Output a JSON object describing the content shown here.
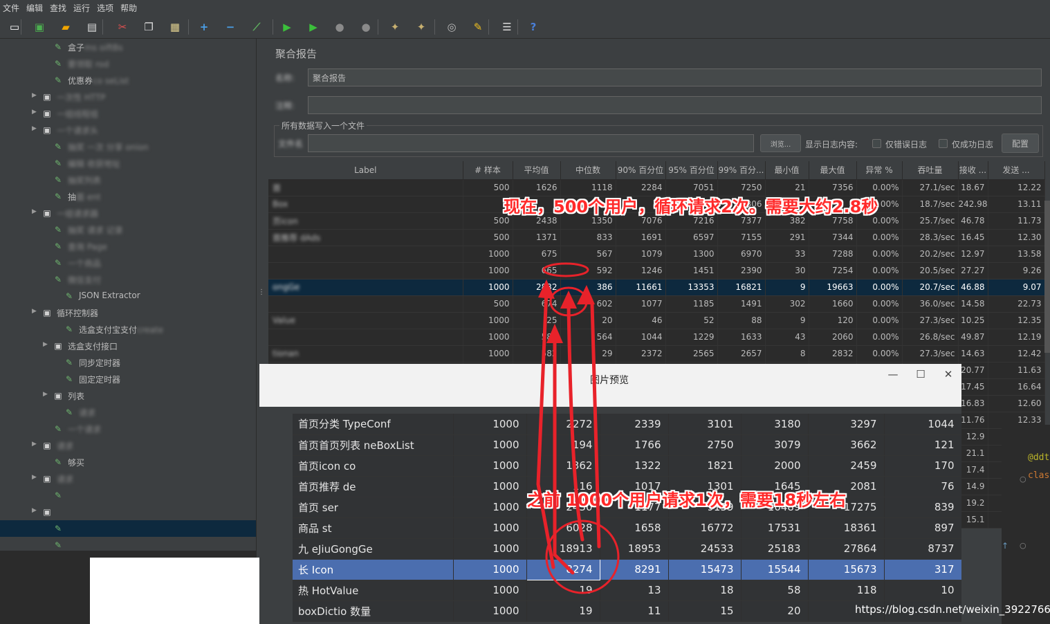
{
  "menu": {
    "items": [
      "文件",
      "编辑",
      "查找",
      "运行",
      "选项",
      "帮助"
    ]
  },
  "toolbar": {
    "icons": [
      "new-icon",
      "templates-icon",
      "open-icon",
      "save-icon",
      "cut-icon",
      "copy-icon",
      "paste-icon",
      "expand-icon",
      "collapse-icon",
      "toggle-icon",
      "start-icon",
      "start-no-pause-icon",
      "stop-icon",
      "shutdown-icon",
      "clear-icon",
      "clear-all-icon",
      "search-icon",
      "reset-search-icon",
      "function-helper-icon",
      "help-icon"
    ]
  },
  "tree": {
    "items": [
      {
        "label": "盒子",
        "blur": "ms oiftBs",
        "indent": 1
      },
      {
        "label": "",
        "blur": "要领取 rod",
        "indent": 1
      },
      {
        "label": "优惠券",
        "blur": "co seList",
        "indent": 1
      },
      {
        "label": "",
        "blur": "一次性 HTTP",
        "indent": 0,
        "expand": true
      },
      {
        "label": "",
        "blur": "一组线程组",
        "indent": 0,
        "expand": true
      },
      {
        "label": "",
        "blur": "一个请求头",
        "indent": 0,
        "expand": true
      },
      {
        "label": "",
        "blur": "抽奖 一次 分享 onion",
        "indent": 1
      },
      {
        "label": "",
        "blur": "编辑 收获地址",
        "indent": 1
      },
      {
        "label": "",
        "blur": "抽奖列表",
        "indent": 1
      },
      {
        "label": "抽",
        "blur": "面 ent",
        "indent": 1
      },
      {
        "label": "",
        "blur": "一组请求器",
        "indent": 0,
        "expand": true
      },
      {
        "label": "",
        "blur": "抽奖 请求 记录",
        "indent": 1
      },
      {
        "label": "",
        "blur": "查询 Page",
        "indent": 1
      },
      {
        "label": "",
        "blur": "一个商品",
        "indent": 1
      },
      {
        "label": "",
        "blur": "微信支付",
        "indent": 1
      },
      {
        "label": "JSON Extractor",
        "blur": "",
        "indent": 2
      },
      {
        "label": "循环控制器",
        "blur": "",
        "indent": 0,
        "expand": true
      },
      {
        "label": "选盒支付宝支付",
        "blur": "create",
        "indent": 2
      },
      {
        "label": "选盒支付接口",
        "blur": "",
        "indent": 1,
        "expand": true
      },
      {
        "label": "同步定时器",
        "blur": "",
        "indent": 2
      },
      {
        "label": "固定定时器",
        "blur": "",
        "indent": 2
      },
      {
        "label": "列表",
        "blur": "",
        "indent": 1,
        "expand": true
      },
      {
        "label": "",
        "blur": "请求",
        "indent": 2
      },
      {
        "label": "",
        "blur": "一个请求",
        "indent": 1
      },
      {
        "label": "",
        "blur": "请求",
        "indent": 0,
        "expand": true
      },
      {
        "label": "够买",
        "blur": "",
        "indent": 1
      },
      {
        "label": "",
        "blur": "请求",
        "indent": 0,
        "expand": true
      },
      {
        "label": "",
        "blur": "",
        "indent": 1
      },
      {
        "label": "",
        "blur": "",
        "indent": 0,
        "expand": true
      },
      {
        "label": "",
        "blur": "",
        "indent": 1
      },
      {
        "label": "",
        "blur": "",
        "indent": 1
      }
    ]
  },
  "panel": {
    "title": "聚合报告",
    "name_label": "名称:",
    "name_value": "聚合报告",
    "comment_label": "注释:",
    "file_section": "所有数据写入一个文件",
    "file_label": "文件名",
    "browse_button": "浏览...",
    "log_label": "显示日志内容:",
    "errors_only": "仅错误日志",
    "success_only": "仅成功日志",
    "config_button": "配置"
  },
  "table": {
    "headers": [
      "Label",
      "# 样本",
      "平均值",
      "中位数",
      "90% 百分位",
      "95% 百分位",
      "99% 百分...",
      "最小值",
      "最大值",
      "异常 %",
      "吞吐量",
      "接收 ...",
      "发送 ..."
    ],
    "rows": [
      {
        "label": "首",
        "cells": [
          "500",
          "1626",
          "1118",
          "2284",
          "7051",
          "7250",
          "21",
          "7356",
          "0.00%",
          "27.1/sec",
          "18.67",
          "12.22"
        ]
      },
      {
        "label": "Box",
        "cells": [
          "1",
          "",
          "",
          "",
          "",
          "7306",
          "",
          "",
          "00%",
          "18.7/sec",
          "242.98",
          "13.11"
        ]
      },
      {
        "label": "页icon",
        "cells": [
          "500",
          "2438",
          "1350",
          "7076",
          "7216",
          "7377",
          "382",
          "7758",
          "0.00%",
          "25.7/sec",
          "46.78",
          "11.73"
        ]
      },
      {
        "label": "首推荐 dAds",
        "cells": [
          "500",
          "1371",
          "833",
          "1691",
          "6597",
          "7155",
          "291",
          "7344",
          "0.00%",
          "28.3/sec",
          "16.45",
          "12.30"
        ]
      },
      {
        "label": "",
        "cells": [
          "1000",
          "675",
          "567",
          "1079",
          "1300",
          "6970",
          "33",
          "7288",
          "0.00%",
          "20.2/sec",
          "12.97",
          "13.58"
        ]
      },
      {
        "label": "",
        "cells": [
          "1000",
          "665",
          "592",
          "1246",
          "1451",
          "2390",
          "30",
          "7254",
          "0.00%",
          "20.5/sec",
          "27.27",
          "9.26"
        ]
      },
      {
        "label": "ongGe",
        "cells": [
          "1000",
          "2832",
          "386",
          "11661",
          "13353",
          "16821",
          "9",
          "19663",
          "0.00%",
          "20.7/sec",
          "46.88",
          "9.07"
        ]
      },
      {
        "label": "",
        "cells": [
          "500",
          "674",
          "602",
          "1077",
          "1185",
          "1491",
          "302",
          "1660",
          "0.00%",
          "36.0/sec",
          "14.58",
          "22.73"
        ]
      },
      {
        "label": "Value",
        "cells": [
          "1000",
          "25",
          "20",
          "46",
          "52",
          "88",
          "9",
          "120",
          "0.00%",
          "27.3/sec",
          "10.25",
          "12.35"
        ]
      },
      {
        "label": "",
        "cells": [
          "1000",
          "581",
          "564",
          "1044",
          "1229",
          "1633",
          "43",
          "2060",
          "0.00%",
          "26.8/sec",
          "49.87",
          "12.19"
        ]
      },
      {
        "label": "tionan",
        "cells": [
          "1000",
          "582",
          "29",
          "2372",
          "2565",
          "2657",
          "8",
          "2832",
          "0.00%",
          "27.3/sec",
          "14.63",
          "12.42"
        ]
      },
      {
        "label": "",
        "cells": [
          "",
          "",
          "",
          "",
          "",
          "",
          "",
          "",
          "",
          "ec",
          "20.77",
          "11.63"
        ]
      },
      {
        "label": "",
        "cells": [
          "",
          "",
          "",
          "",
          "",
          "",
          "",
          "",
          "",
          "ec",
          "17.45",
          "16.64"
        ]
      },
      {
        "label": "",
        "cells": [
          "",
          "",
          "",
          "",
          "",
          "",
          "",
          "",
          "",
          "ec",
          "16.83",
          "12.60"
        ]
      },
      {
        "label": "",
        "cells": [
          "",
          "",
          "",
          "",
          "",
          "",
          "",
          "",
          "",
          "ec",
          "11.76",
          "12.33"
        ]
      },
      {
        "label": "",
        "cells": [
          "",
          "",
          "",
          "",
          "",
          "",
          "",
          "",
          "",
          "ec",
          "12.9",
          ""
        ]
      },
      {
        "label": "",
        "cells": [
          "",
          "",
          "",
          "",
          "",
          "",
          "",
          "",
          "",
          "ec",
          "21.1",
          ""
        ]
      },
      {
        "label": "",
        "cells": [
          "",
          "",
          "",
          "",
          "",
          "",
          "",
          "",
          "",
          "ec",
          "17.4",
          ""
        ]
      },
      {
        "label": "",
        "cells": [
          "",
          "",
          "",
          "",
          "",
          "",
          "",
          "",
          "",
          "ec",
          "14.9",
          ""
        ]
      },
      {
        "label": "",
        "cells": [
          "",
          "",
          "",
          "",
          "",
          "",
          "",
          "",
          "",
          "ec",
          "19.2",
          ""
        ]
      },
      {
        "label": "",
        "cells": [
          "",
          "",
          "",
          "",
          "",
          "",
          "",
          "",
          "",
          "ec",
          "15.1",
          ""
        ]
      }
    ]
  },
  "ide": {
    "annotation": "@ddt",
    "keyword": "clas"
  },
  "popup": {
    "title": "图片预览",
    "rows": [
      {
        "label": "首页分类 TypeConf",
        "cells": [
          "1000",
          "2272",
          "2339",
          "3101",
          "3180",
          "3297",
          "1044"
        ]
      },
      {
        "label": "首页首页列表 neBoxList",
        "cells": [
          "1000",
          "194",
          "1766",
          "2750",
          "3079",
          "3662",
          "121"
        ]
      },
      {
        "label": "首页icon co",
        "cells": [
          "1000",
          "1362",
          "1322",
          "1821",
          "2000",
          "2459",
          "170"
        ]
      },
      {
        "label": "首页推荐 de",
        "cells": [
          "1000",
          "116",
          "1017",
          "1301",
          "1645",
          "2081",
          "76"
        ]
      },
      {
        "label": "首页 ser",
        "cells": [
          "1000",
          "2430",
          "1177",
          "9139",
          "10489",
          "17275",
          "839"
        ]
      },
      {
        "label": "商品 st",
        "cells": [
          "1000",
          "6028",
          "1658",
          "16772",
          "17531",
          "18361",
          "897"
        ]
      },
      {
        "label": "九 eJiuGongGe",
        "cells": [
          "1000",
          "18913",
          "18953",
          "24533",
          "25183",
          "27864",
          "8737"
        ]
      },
      {
        "label": "长 Icon",
        "cells": [
          "1000",
          "8274",
          "8291",
          "15473",
          "15544",
          "15673",
          "317"
        ]
      },
      {
        "label": "热 HotValue",
        "cells": [
          "1000",
          "19",
          "13",
          "18",
          "58",
          "118",
          "10"
        ]
      },
      {
        "label": "boxDictio 数量",
        "cells": [
          "1000",
          "19",
          "11",
          "15",
          "20",
          "",
          ""
        ]
      }
    ]
  },
  "annotations": {
    "caption_now": "现在，500个用户，循环请求2次。需要大约2.8秒",
    "caption_before": "之前 1000个用户请求1次，需要18秒左右",
    "color": "#ff2a2a"
  },
  "watermark": "https://blog.csdn.net/weixin_39227662"
}
